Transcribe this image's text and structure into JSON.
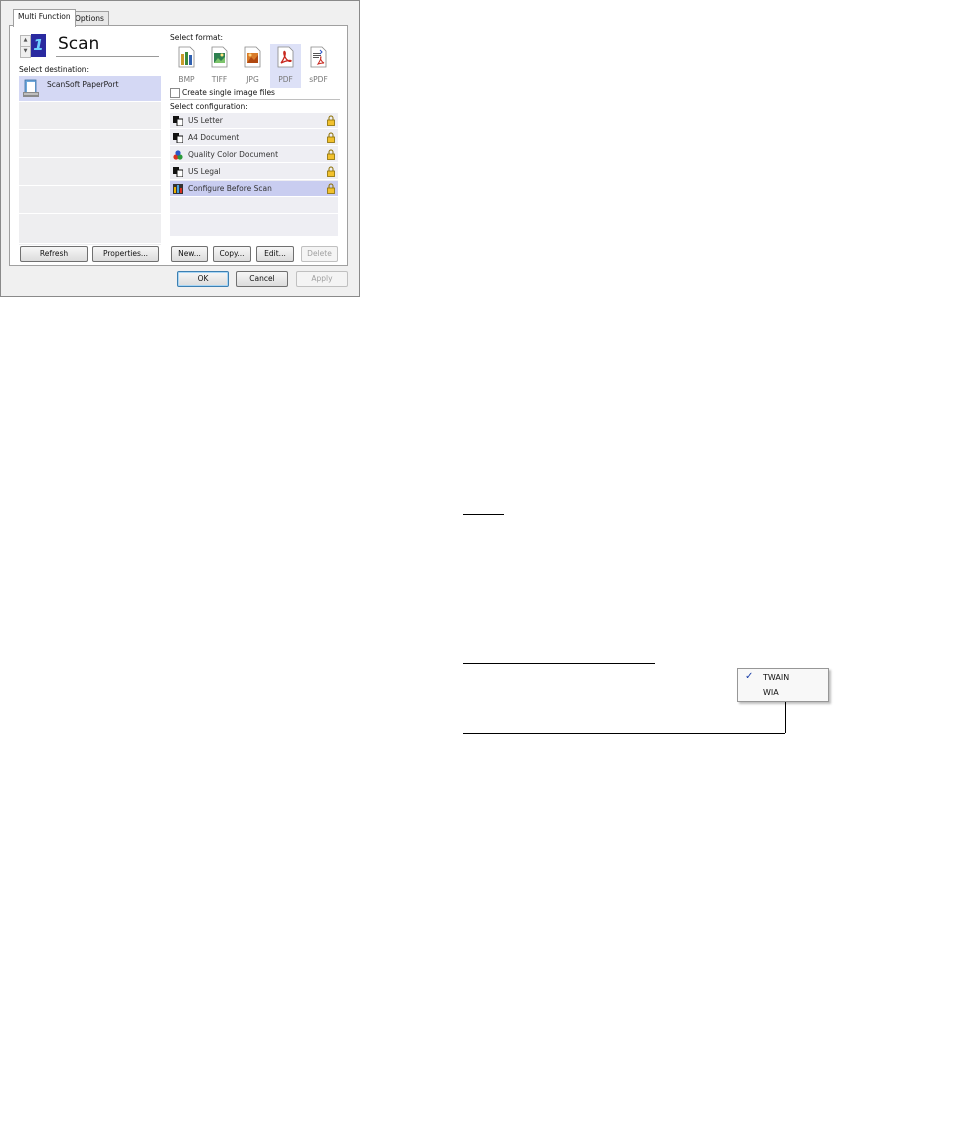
{
  "tabs": [
    {
      "label": "Multi Function",
      "active": true
    },
    {
      "label": "Options",
      "active": false
    }
  ],
  "scan_button": {
    "title": "Scan",
    "number": "1"
  },
  "destination": {
    "label": "Select destination:",
    "items": [
      {
        "name": "ScanSoft PaperPort",
        "selected": true
      }
    ],
    "refresh_button": "Refresh",
    "properties_button": "Properties..."
  },
  "format": {
    "label": "Select format:",
    "items": [
      {
        "name": "BMP",
        "selected": false
      },
      {
        "name": "TIFF",
        "selected": false
      },
      {
        "name": "JPG",
        "selected": false
      },
      {
        "name": "PDF",
        "selected": true
      },
      {
        "name": "sPDF",
        "selected": false
      }
    ],
    "single_image_label": "Create single image files",
    "single_image_checked": false
  },
  "configuration": {
    "label": "Select configuration:",
    "items": [
      {
        "name": "US Letter",
        "icon": "bw-pages-icon",
        "locked": true
      },
      {
        "name": "A4 Document",
        "icon": "bw-pages-icon",
        "locked": true
      },
      {
        "name": "Quality Color Document",
        "icon": "color-dots-icon",
        "locked": true
      },
      {
        "name": "US Legal",
        "icon": "bw-pages-icon",
        "locked": true
      },
      {
        "name": "Configure Before Scan",
        "icon": "configure-bars-icon",
        "locked": true,
        "selected": true
      }
    ],
    "new_button": "New...",
    "copy_button": "Copy...",
    "edit_button": "Edit...",
    "delete_button": "Delete"
  },
  "context_menu": {
    "items": [
      {
        "label": "TWAIN",
        "checked": true
      },
      {
        "label": "WIA",
        "checked": false
      }
    ]
  },
  "footer": {
    "ok": "OK",
    "cancel": "Cancel",
    "apply": "Apply"
  },
  "colors": {
    "selection": "#d4d8f4",
    "accent": "#2a2aa0"
  }
}
